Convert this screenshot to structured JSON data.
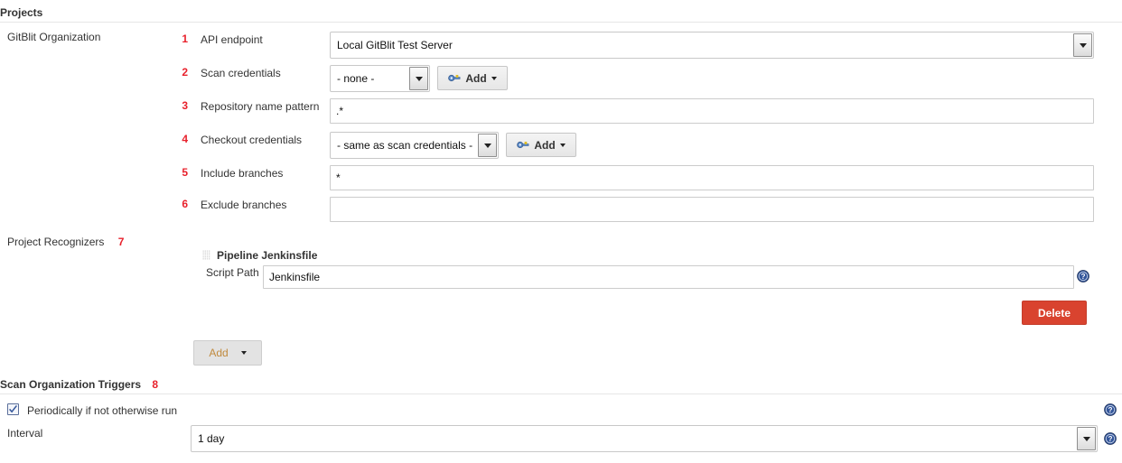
{
  "sections": {
    "projects": {
      "title": "Projects",
      "marker": ""
    },
    "project_recognizers": {
      "title": "Project Recognizers",
      "marker": "7"
    },
    "scan_triggers": {
      "title": "Scan Organization Triggers",
      "marker": "8"
    }
  },
  "gitblit": {
    "gutter_label": "GitBlit Organization",
    "rows": [
      {
        "marker": "1",
        "label": "API endpoint",
        "type": "select",
        "value": "Local GitBlit Test Server"
      },
      {
        "marker": "2",
        "label": "Scan credentials",
        "type": "select-with-add",
        "value": "- none -",
        "add_label": "Add"
      },
      {
        "marker": "3",
        "label": "Repository name pattern",
        "type": "text",
        "value": ".*",
        "placeholder": ""
      },
      {
        "marker": "4",
        "label": "Checkout credentials",
        "type": "select-with-add",
        "value": "- same as scan credentials -",
        "add_label": "Add"
      },
      {
        "marker": "5",
        "label": "Include branches",
        "type": "text",
        "value": "*",
        "placeholder": ""
      },
      {
        "marker": "6",
        "label": "Exclude branches",
        "type": "text",
        "value": "",
        "placeholder": ""
      }
    ]
  },
  "recognizer": {
    "name": "Pipeline Jenkinsfile",
    "script_path_label": "Script Path",
    "script_path_value": "Jenkinsfile",
    "delete_label": "Delete",
    "add_label": "Add"
  },
  "triggers": {
    "periodic_label": "Periodically if not otherwise run",
    "periodic_checked": true,
    "interval_label": "Interval",
    "interval_value": "1 day"
  },
  "colors": {
    "marker_red": "#e8212c",
    "delete_red": "#d9432f",
    "help_blue": "#33569b",
    "input_border": "#cccccc",
    "rule_grey": "#e6e6e6"
  },
  "icons": {
    "help": "help-circle-icon",
    "key": "key-icon",
    "drag": "drag-handle-icon",
    "caret": "chevron-down-icon"
  }
}
